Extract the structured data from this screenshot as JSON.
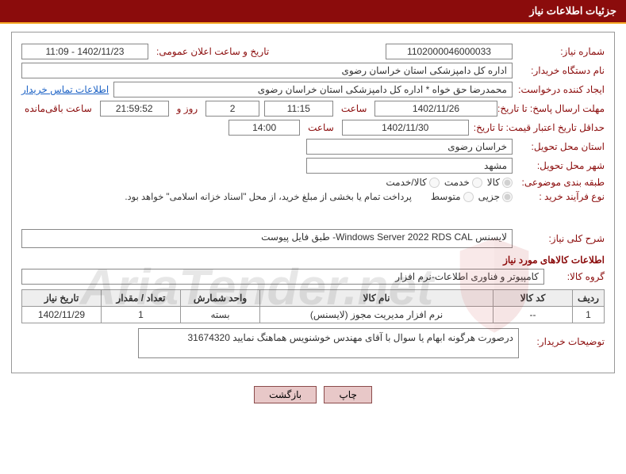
{
  "header": {
    "title": "جزئیات اطلاعات نیاز"
  },
  "labels": {
    "need_no": "شماره نیاز:",
    "announce_dt": "تاریخ و ساعت اعلان عمومی:",
    "buyer_org": "نام دستگاه خریدار:",
    "requester": "ایجاد کننده درخواست:",
    "buyer_contact": "اطلاعات تماس خریدار",
    "reply_deadline": "مهلت ارسال پاسخ: تا تاریخ:",
    "saat": "ساعت",
    "rooz_va": "روز و",
    "remaining": "ساعت باقی‌مانده",
    "min_validity": "حداقل تاریخ اعتبار قیمت: تا تاریخ:",
    "delivery_province": "استان محل تحویل:",
    "delivery_city": "شهر محل تحویل:",
    "category": "طبقه بندی موضوعی:",
    "purchase_type": "نوع فرآیند خرید :",
    "cat_goods": "کالا",
    "cat_service": "خدمت",
    "cat_both": "کالا/خدمت",
    "pt_partial": "جزیی",
    "pt_medium": "متوسط",
    "pay_note": "پرداخت تمام یا بخشی از مبلغ خرید، از محل \"اسناد خزانه اسلامی\" خواهد بود.",
    "need_desc": "شرح کلی نیاز:",
    "items_title": "اطلاعات کالاهای مورد نیاز",
    "goods_group": "گروه کالا:",
    "th_row": "ردیف",
    "th_code": "کد کالا",
    "th_name": "نام کالا",
    "th_unit": "واحد شمارش",
    "th_qty": "تعداد / مقدار",
    "th_date": "تاریخ نیاز",
    "buyer_notes_lbl": "توضیحات خریدار:"
  },
  "values": {
    "need_no": "1102000046000033",
    "announce_dt": "1402/11/23 - 11:09",
    "buyer_org": "اداره کل دامپزشکی استان خراسان رضوی",
    "requester": "محمدرضا حق خواه * اداره کل دامپزشکی استان خراسان رضوی",
    "reply_date": "1402/11/26",
    "reply_time": "11:15",
    "remaining_days": "2",
    "remaining_hms": "21:59:52",
    "validity_date": "1402/11/30",
    "validity_time": "14:00",
    "province": "خراسان رضوی",
    "city": "مشهد",
    "need_desc": "لایسنس Windows Server 2022 RDS CAL- طبق فایل پیوست",
    "goods_group": "کامپیوتر و فناوری اطلاعات-نرم افزار",
    "buyer_notes": "درصورت هرگونه ابهام یا سوال با آقای مهندس خوشنویس هماهنگ نمایید 31674320"
  },
  "items": [
    {
      "row": "1",
      "code": "--",
      "name": "نرم افزار مدیریت مجوز (لایسنس)",
      "unit": "بسته",
      "qty": "1",
      "date": "1402/11/29"
    }
  ],
  "buttons": {
    "print": "چاپ",
    "back": "بازگشت"
  },
  "watermark": "AriaTender.net"
}
